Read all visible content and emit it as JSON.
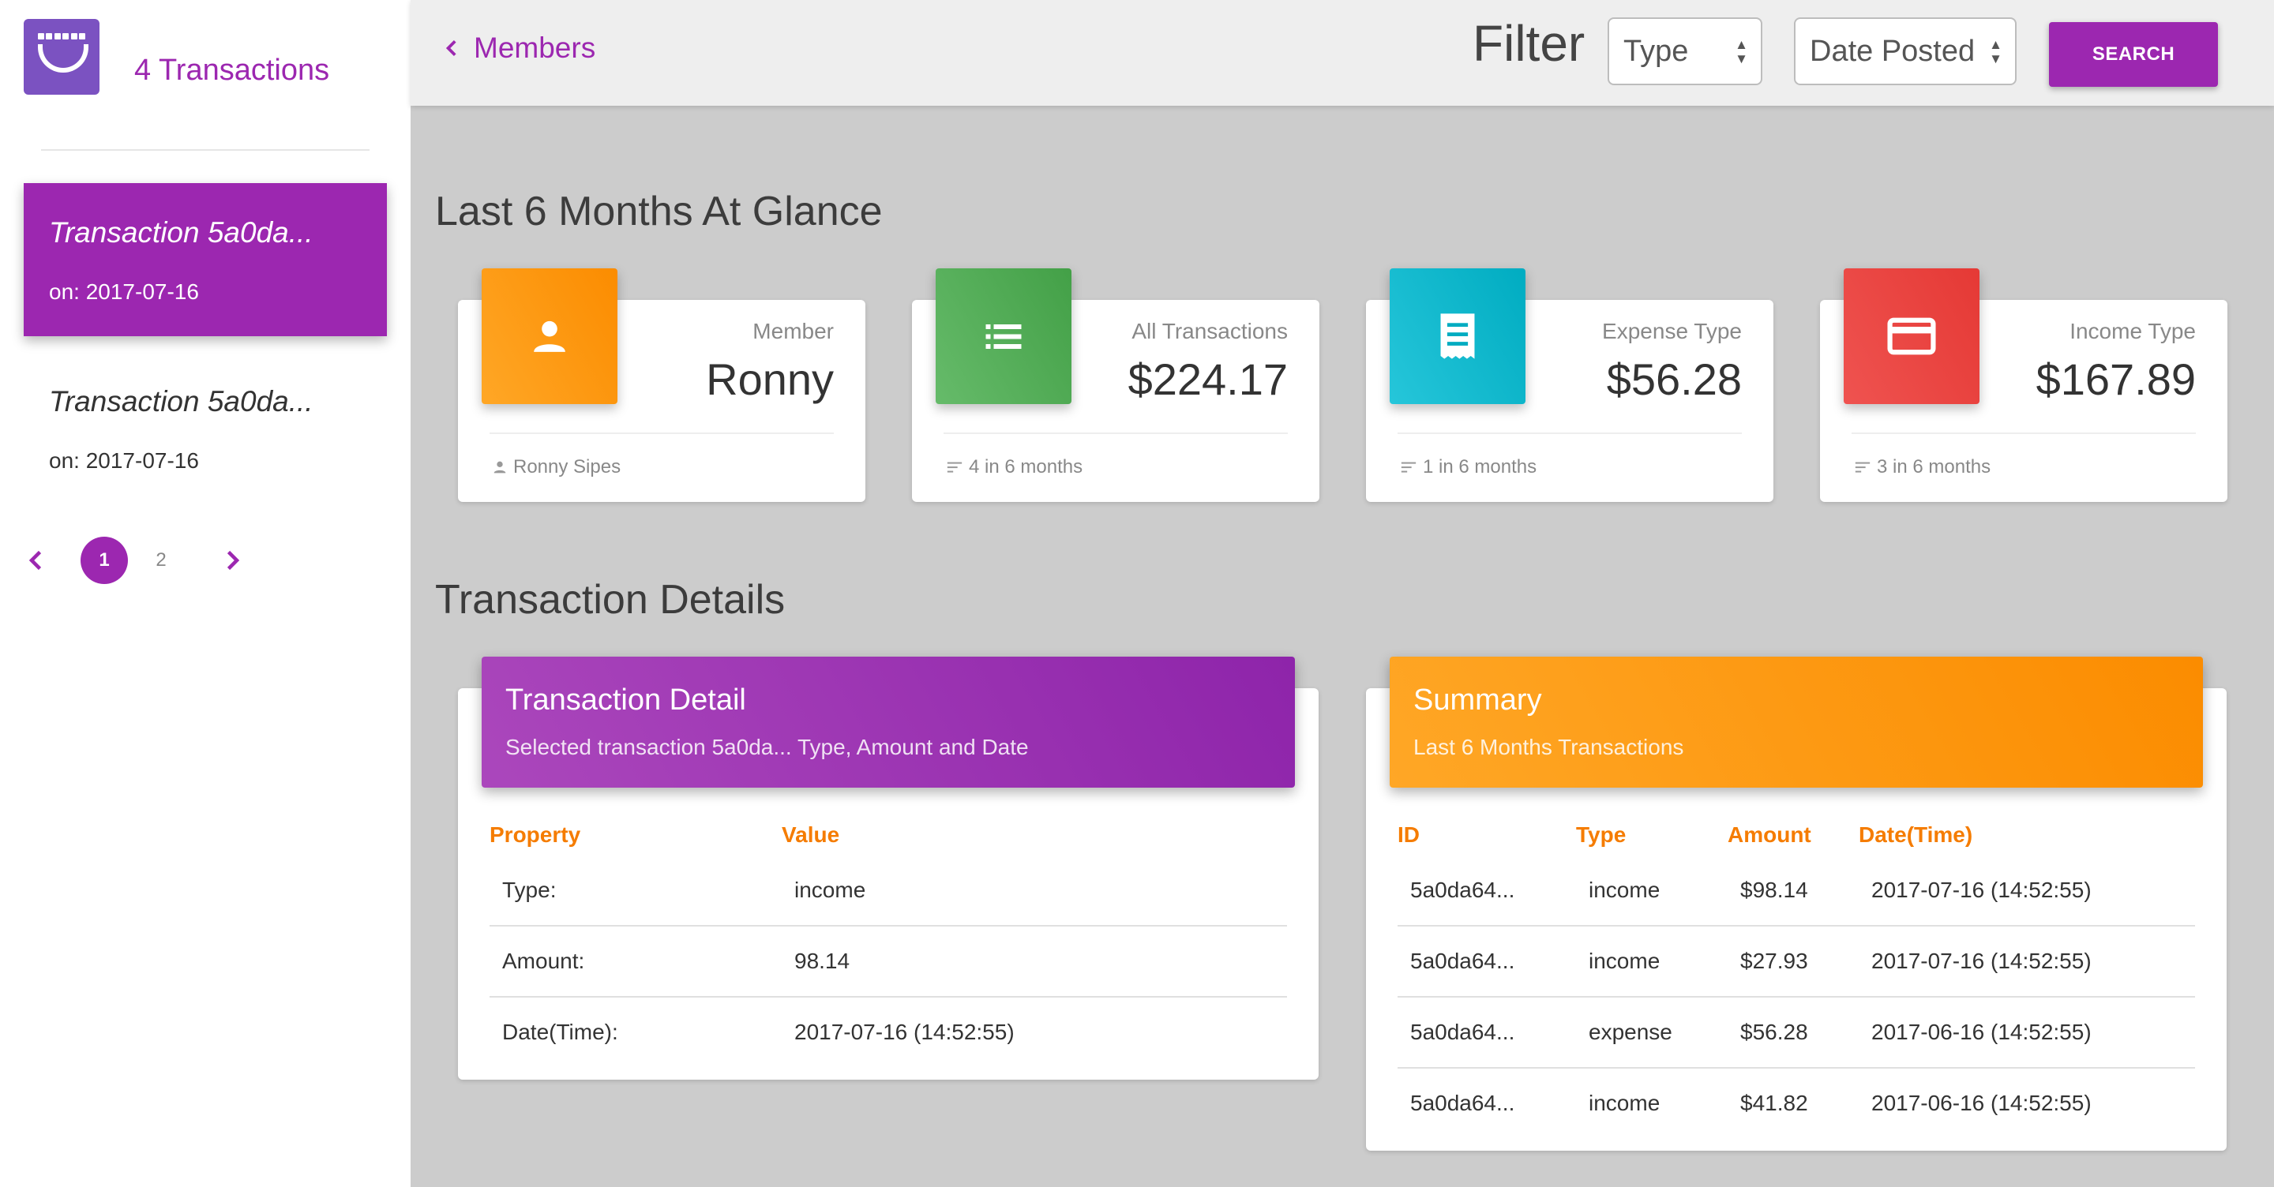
{
  "sidebar": {
    "title": "4 Transactions",
    "items": [
      {
        "title": "Transaction 5a0da...",
        "date": "on: 2017-07-16"
      },
      {
        "title": "Transaction 5a0da...",
        "date": "on: 2017-07-16"
      }
    ],
    "pages": [
      "1",
      "2"
    ]
  },
  "topbar": {
    "back_label": "Members",
    "filter_label": "Filter",
    "type_select": "Type",
    "date_select": "Date Posted",
    "search_label": "SEARCH"
  },
  "glance": {
    "title": "Last 6 Months At Glance",
    "cards": [
      {
        "label": "Member",
        "value": "Ronny",
        "foot": "Ronny Sipes",
        "color": "#ff9800",
        "icon": "person-icon"
      },
      {
        "label": "All Transactions",
        "value": "$224.17",
        "foot": "4 in 6 months",
        "color": "#4caf50",
        "icon": "list-icon"
      },
      {
        "label": "Expense Type",
        "value": "$56.28",
        "foot": "1 in 6 months",
        "color": "#26c6da",
        "icon": "receipt-icon"
      },
      {
        "label": "Income Type",
        "value": "$167.89",
        "foot": "3 in 6 months",
        "color": "#e53935",
        "icon": "credit-card-icon"
      }
    ]
  },
  "details": {
    "title": "Transaction Details",
    "detail_panel": {
      "title": "Transaction Detail",
      "subtitle": "Selected transaction 5a0da... Type, Amount and Date",
      "columns": [
        "Property",
        "Value"
      ],
      "rows": [
        [
          "Type:",
          "income"
        ],
        [
          "Amount:",
          "98.14"
        ],
        [
          "Date(Time):",
          "2017-07-16 (14:52:55)"
        ]
      ]
    },
    "summary_panel": {
      "title": "Summary",
      "subtitle": "Last 6 Months Transactions",
      "columns": [
        "ID",
        "Type",
        "Amount",
        "Date(Time)"
      ],
      "rows": [
        [
          "5a0da64...",
          "income",
          "$98.14",
          "2017-07-16 (14:52:55)"
        ],
        [
          "5a0da64...",
          "income",
          "$27.93",
          "2017-07-16 (14:52:55)"
        ],
        [
          "5a0da64...",
          "expense",
          "$56.28",
          "2017-06-16 (14:52:55)"
        ],
        [
          "5a0da64...",
          "income",
          "$41.82",
          "2017-06-16 (14:52:55)"
        ]
      ]
    }
  },
  "colors": {
    "accent": "#9c27b0",
    "header_orange": "#f57c00",
    "background": "#cccccc"
  }
}
